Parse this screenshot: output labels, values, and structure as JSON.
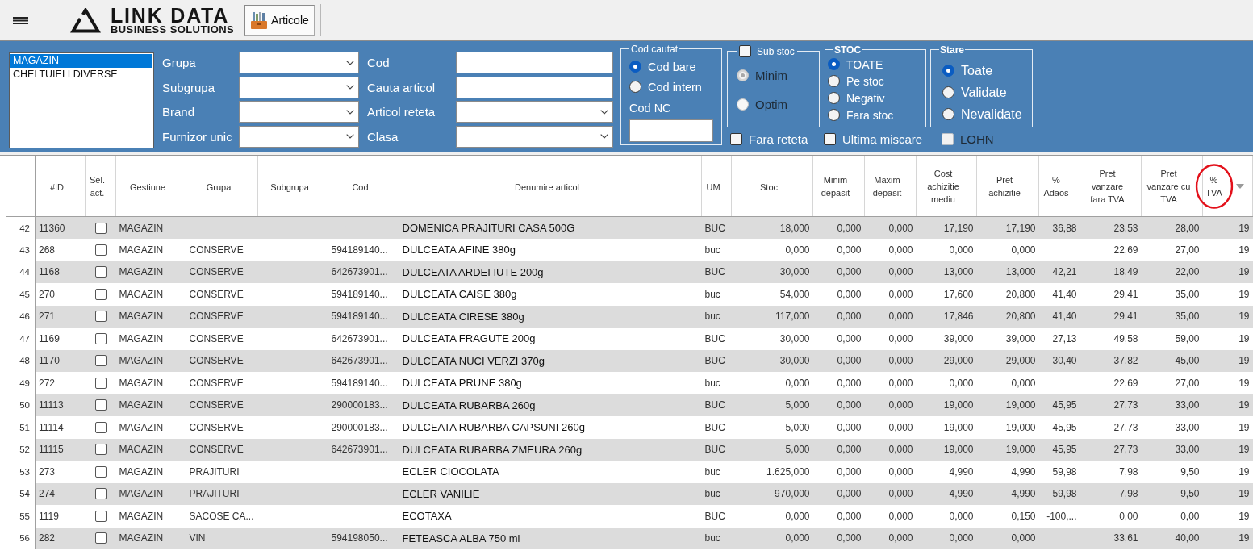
{
  "app_bar": {
    "logo": {
      "name": "LINK DATA",
      "tagline": "BUSINESS SOLUTIONS"
    },
    "tabs": [
      {
        "label": "Articole",
        "selected": true
      }
    ]
  },
  "filters": {
    "gestiuni": [
      {
        "label": "MAGAZIN",
        "selected": true
      },
      {
        "label": "CHELTUIELI DIVERSE",
        "selected": false
      }
    ],
    "fields": [
      {
        "label": "Grupa",
        "kind": "combo"
      },
      {
        "label": "Cod",
        "kind": "text"
      },
      {
        "label": "Subgrupa",
        "kind": "combo"
      },
      {
        "label": "Cauta articol",
        "kind": "text"
      },
      {
        "label": "Brand",
        "kind": "combo"
      },
      {
        "label": "Articol reteta",
        "kind": "combo"
      },
      {
        "label": "Furnizor unic",
        "kind": "combo"
      },
      {
        "label": "Clasa",
        "kind": "combo"
      }
    ],
    "cod_cautat": {
      "title": "Cod cautat",
      "options": [
        {
          "label": "Cod bare",
          "selected": true,
          "disabled": false
        },
        {
          "label": "Cod intern",
          "selected": false,
          "disabled": false
        }
      ],
      "cod_nc_label": "Cod NC"
    },
    "sub_stoc": {
      "title": "Sub stoc",
      "checked": false,
      "options": [
        {
          "label": "Minim",
          "selected": true,
          "disabled": true
        },
        {
          "label": "Optim",
          "selected": false,
          "disabled": true
        }
      ]
    },
    "stoc": {
      "title": "STOC",
      "options": [
        {
          "label": "TOATE",
          "selected": true,
          "disabled": false
        },
        {
          "label": "Pe stoc",
          "selected": false,
          "disabled": false
        },
        {
          "label": "Negativ",
          "selected": false,
          "disabled": false
        },
        {
          "label": "Fara stoc",
          "selected": false,
          "disabled": false
        }
      ]
    },
    "stare": {
      "title": "Stare",
      "options": [
        {
          "label": "Toate",
          "selected": true,
          "disabled": false
        },
        {
          "label": "Validate",
          "selected": false,
          "disabled": false
        },
        {
          "label": "Nevalidate",
          "selected": false,
          "disabled": false
        }
      ]
    },
    "checkboxes": [
      {
        "label": "Fara reteta",
        "checked": false,
        "disabled": false
      },
      {
        "label": "Ultima miscare",
        "checked": false,
        "disabled": false
      },
      {
        "label": "LOHN",
        "checked": false,
        "disabled": true
      }
    ]
  },
  "table": {
    "columns": [
      {
        "label": "#ID",
        "kind": "text",
        "circled": false
      },
      {
        "label": "Sel.\nact.",
        "kind": "check",
        "circled": false
      },
      {
        "label": "Gestiune",
        "kind": "text",
        "circled": false
      },
      {
        "label": "Grupa",
        "kind": "text",
        "circled": false
      },
      {
        "label": "Subgrupa",
        "kind": "text",
        "circled": false
      },
      {
        "label": "Cod",
        "kind": "text",
        "circled": false
      },
      {
        "label": "Denumire articol",
        "kind": "name",
        "circled": false
      },
      {
        "label": "UM",
        "kind": "text",
        "circled": false
      },
      {
        "label": "Stoc",
        "kind": "number",
        "circled": false
      },
      {
        "label": "Minim\ndepasit",
        "kind": "number",
        "circled": false
      },
      {
        "label": "Maxim\ndepasit",
        "kind": "number",
        "circled": false
      },
      {
        "label": "Cost\nachizitie\nmediu",
        "kind": "number",
        "circled": false
      },
      {
        "label": "Pret\nachizitie",
        "kind": "number",
        "circled": false
      },
      {
        "label": "%\nAdaos",
        "kind": "number",
        "circled": false
      },
      {
        "label": "Pret\nvanzare\nfara TVA",
        "kind": "number",
        "circled": false
      },
      {
        "label": "Pret\nvanzare cu\nTVA",
        "kind": "number",
        "circled": false
      },
      {
        "label": "%\nTVA",
        "kind": "number",
        "circled": true
      }
    ],
    "rows": [
      {
        "row_number": "42",
        "id": "11360",
        "checked": false,
        "gestiune": "MAGAZIN",
        "denumire": "DOMENICA PRAJITURI CASA 500G",
        "um": "BUC",
        "stoc": "18,000",
        "minim": "0,000",
        "maxim": "0,000",
        "cost_mediu": "17,190",
        "pret_achizitie": "17,190",
        "adaos": "36,88",
        "pret_fara_tva": "23,53",
        "pret_cu_tva": "28,00",
        "tva": "19"
      },
      {
        "row_number": "43",
        "id": "268",
        "checked": false,
        "gestiune": "MAGAZIN",
        "grupa": "CONSERVE",
        "cod": "594189140...",
        "denumire": "DULCEATA AFINE 380g",
        "um": "buc",
        "stoc": "0,000",
        "minim": "0,000",
        "maxim": "0,000",
        "cost_mediu": "0,000",
        "pret_achizitie": "0,000",
        "pret_fara_tva": "22,69",
        "pret_cu_tva": "27,00",
        "tva": "19"
      },
      {
        "row_number": "44",
        "id": "1168",
        "checked": false,
        "gestiune": "MAGAZIN",
        "grupa": "CONSERVE",
        "cod": "642673901...",
        "denumire": "DULCEATA ARDEI IUTE 200g",
        "um": "BUC",
        "stoc": "30,000",
        "minim": "0,000",
        "maxim": "0,000",
        "cost_mediu": "13,000",
        "pret_achizitie": "13,000",
        "adaos": "42,21",
        "pret_fara_tva": "18,49",
        "pret_cu_tva": "22,00",
        "tva": "19"
      },
      {
        "row_number": "45",
        "id": "270",
        "checked": false,
        "gestiune": "MAGAZIN",
        "grupa": "CONSERVE",
        "cod": "594189140...",
        "denumire": "DULCEATA CAISE 380g",
        "um": "buc",
        "stoc": "54,000",
        "minim": "0,000",
        "maxim": "0,000",
        "cost_mediu": "17,600",
        "pret_achizitie": "20,800",
        "adaos": "41,40",
        "pret_fara_tva": "29,41",
        "pret_cu_tva": "35,00",
        "tva": "19"
      },
      {
        "row_number": "46",
        "id": "271",
        "checked": false,
        "gestiune": "MAGAZIN",
        "grupa": "CONSERVE",
        "cod": "594189140...",
        "denumire": "DULCEATA CIRESE 380g",
        "um": "buc",
        "stoc": "117,000",
        "minim": "0,000",
        "maxim": "0,000",
        "cost_mediu": "17,846",
        "pret_achizitie": "20,800",
        "adaos": "41,40",
        "pret_fara_tva": "29,41",
        "pret_cu_tva": "35,00",
        "tva": "19"
      },
      {
        "row_number": "47",
        "id": "1169",
        "checked": false,
        "gestiune": "MAGAZIN",
        "grupa": "CONSERVE",
        "cod": "642673901...",
        "denumire": "DULCEATA FRAGUTE 200g",
        "um": "BUC",
        "stoc": "30,000",
        "minim": "0,000",
        "maxim": "0,000",
        "cost_mediu": "39,000",
        "pret_achizitie": "39,000",
        "adaos": "27,13",
        "pret_fara_tva": "49,58",
        "pret_cu_tva": "59,00",
        "tva": "19"
      },
      {
        "row_number": "48",
        "id": "1170",
        "checked": false,
        "gestiune": "MAGAZIN",
        "grupa": "CONSERVE",
        "cod": "642673901...",
        "denumire": "DULCEATA NUCI VERZI 370g",
        "um": "BUC",
        "stoc": "30,000",
        "minim": "0,000",
        "maxim": "0,000",
        "cost_mediu": "29,000",
        "pret_achizitie": "29,000",
        "adaos": "30,40",
        "pret_fara_tva": "37,82",
        "pret_cu_tva": "45,00",
        "tva": "19"
      },
      {
        "row_number": "49",
        "id": "272",
        "checked": false,
        "gestiune": "MAGAZIN",
        "grupa": "CONSERVE",
        "cod": "594189140...",
        "denumire": "DULCEATA PRUNE 380g",
        "um": "buc",
        "stoc": "0,000",
        "minim": "0,000",
        "maxim": "0,000",
        "cost_mediu": "0,000",
        "pret_achizitie": "0,000",
        "pret_fara_tva": "22,69",
        "pret_cu_tva": "27,00",
        "tva": "19"
      },
      {
        "row_number": "50",
        "id": "11113",
        "checked": false,
        "gestiune": "MAGAZIN",
        "grupa": "CONSERVE",
        "cod": "290000183...",
        "denumire": "DULCEATA RUBARBA 260g",
        "um": "BUC",
        "stoc": "5,000",
        "minim": "0,000",
        "maxim": "0,000",
        "cost_mediu": "19,000",
        "pret_achizitie": "19,000",
        "adaos": "45,95",
        "pret_fara_tva": "27,73",
        "pret_cu_tva": "33,00",
        "tva": "19"
      },
      {
        "row_number": "51",
        "id": "11114",
        "checked": false,
        "gestiune": "MAGAZIN",
        "grupa": "CONSERVE",
        "cod": "290000183...",
        "denumire": "DULCEATA RUBARBA CAPSUNI 260g",
        "um": "BUC",
        "stoc": "5,000",
        "minim": "0,000",
        "maxim": "0,000",
        "cost_mediu": "19,000",
        "pret_achizitie": "19,000",
        "adaos": "45,95",
        "pret_fara_tva": "27,73",
        "pret_cu_tva": "33,00",
        "tva": "19"
      },
      {
        "row_number": "52",
        "id": "11115",
        "checked": false,
        "gestiune": "MAGAZIN",
        "grupa": "CONSERVE",
        "cod": "642673901...",
        "denumire": "DULCEATA RUBARBA ZMEURA 260g",
        "um": "BUC",
        "stoc": "5,000",
        "minim": "0,000",
        "maxim": "0,000",
        "cost_mediu": "19,000",
        "pret_achizitie": "19,000",
        "adaos": "45,95",
        "pret_fara_tva": "27,73",
        "pret_cu_tva": "33,00",
        "tva": "19"
      },
      {
        "row_number": "53",
        "id": "273",
        "checked": false,
        "gestiune": "MAGAZIN",
        "grupa": "PRAJITURI",
        "denumire": "ECLER CIOCOLATA",
        "um": "buc",
        "stoc": "1.625,000",
        "minim": "0,000",
        "maxim": "0,000",
        "cost_mediu": "4,990",
        "pret_achizitie": "4,990",
        "adaos": "59,98",
        "pret_fara_tva": "7,98",
        "pret_cu_tva": "9,50",
        "tva": "19"
      },
      {
        "row_number": "54",
        "id": "274",
        "checked": false,
        "gestiune": "MAGAZIN",
        "grupa": "PRAJITURI",
        "denumire": "ECLER VANILIE",
        "um": "buc",
        "stoc": "970,000",
        "minim": "0,000",
        "maxim": "0,000",
        "cost_mediu": "4,990",
        "pret_achizitie": "4,990",
        "adaos": "59,98",
        "pret_fara_tva": "7,98",
        "pret_cu_tva": "9,50",
        "tva": "19"
      },
      {
        "row_number": "55",
        "id": "1119",
        "checked": false,
        "gestiune": "MAGAZIN",
        "grupa": "SACOSE CA...",
        "denumire": "ECOTAXA",
        "um": "BUC",
        "stoc": "0,000",
        "minim": "0,000",
        "maxim": "0,000",
        "cost_mediu": "0,000",
        "pret_achizitie": "0,150",
        "adaos": "-100,...",
        "pret_fara_tva": "0,00",
        "pret_cu_tva": "0,00",
        "tva": "19"
      },
      {
        "row_number": "56",
        "id": "282",
        "checked": false,
        "gestiune": "MAGAZIN",
        "grupa": "VIN",
        "cod": "594198050...",
        "denumire": "FETEASCA ALBA 750 ml",
        "um": "buc",
        "stoc": "0,000",
        "minim": "0,000",
        "maxim": "0,000",
        "cost_mediu": "0,000",
        "pret_achizitie": "0,000",
        "pret_fara_tva": "33,61",
        "pret_cu_tva": "40,00",
        "tva": "19"
      }
    ]
  }
}
